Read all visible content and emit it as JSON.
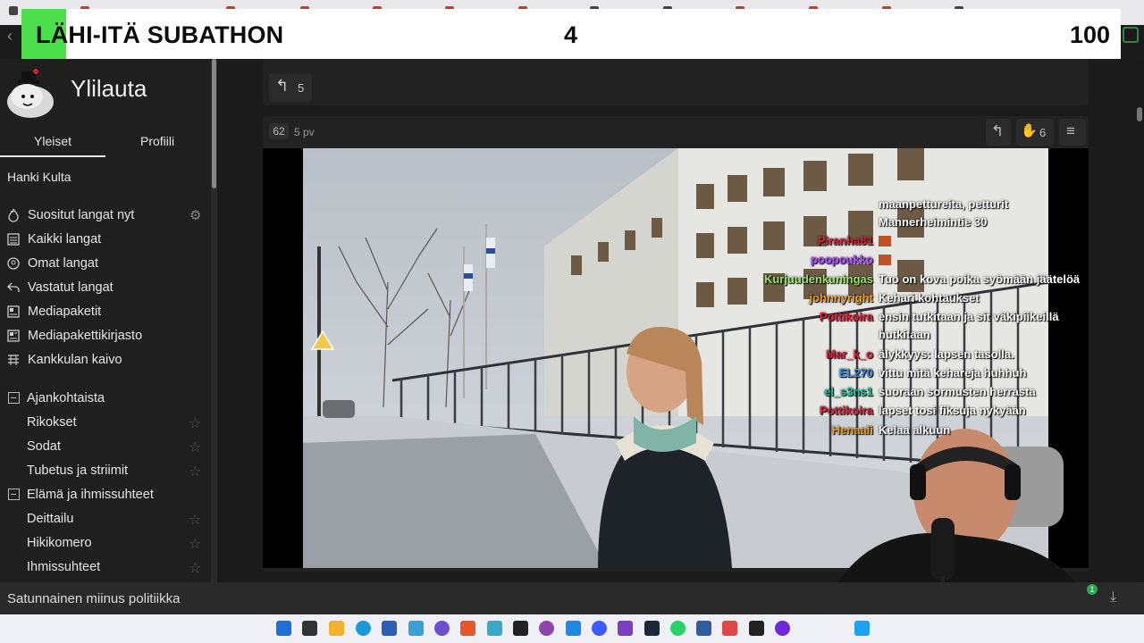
{
  "banner": {
    "title": "LÄHI-ITÄ SUBATHON",
    "count": "4",
    "goal": "100"
  },
  "site": {
    "title": "Ylilauta"
  },
  "sidebar": {
    "tabs": [
      {
        "label": "Yleiset"
      },
      {
        "label": "Profiili"
      }
    ],
    "hanki": "Hanki Kulta",
    "nav": [
      {
        "label": "Suositut langat nyt",
        "icon": "fire-icon"
      },
      {
        "label": "Kaikki langat",
        "icon": "list-icon"
      },
      {
        "label": "Omat langat",
        "icon": "chat-icon"
      },
      {
        "label": "Vastatut langat",
        "icon": "reply-icon"
      },
      {
        "label": "Mediapaketit",
        "icon": "media-icon"
      },
      {
        "label": "Mediapakettikirjasto",
        "icon": "library-icon"
      },
      {
        "label": "Kankkulan kaivo",
        "icon": "well-icon"
      }
    ],
    "categories": [
      {
        "label": "Ajankohtaista",
        "subs": [
          {
            "label": "Rikokset"
          },
          {
            "label": "Sodat"
          },
          {
            "label": "Tubetus ja striimit"
          }
        ]
      },
      {
        "label": "Elämä ja ihmissuhteet",
        "subs": [
          {
            "label": "Deittailu"
          },
          {
            "label": "Hikikomero"
          },
          {
            "label": "Ihmissuhteet"
          }
        ]
      }
    ]
  },
  "post_prev": {
    "reply_count": "5"
  },
  "post": {
    "number": "62",
    "age": "5 pv",
    "likes": "6"
  },
  "chat": [
    {
      "name": "",
      "color": "#ffffff",
      "msg": "maanpettureita, petturit"
    },
    {
      "name": "",
      "color": "#ffffff",
      "msg": "Mannerheimintie 30"
    },
    {
      "name": "Piranha81",
      "color": "#e2233e",
      "msg": ""
    },
    {
      "name": "poopoukko",
      "color": "#b44cff",
      "msg": ""
    },
    {
      "name": "Kurjuudenkuningas",
      "color": "#9be36b",
      "msg": "Tuo on kova poika syömään jäätelöä"
    },
    {
      "name": "johnnyright",
      "color": "#f0a020",
      "msg": "Kehari kohtaukset"
    },
    {
      "name": "Pottikoira",
      "color": "#e2233e",
      "msg": "ensin tutkitaan ja sit väkipiikeillä"
    },
    {
      "name": "",
      "color": "#ffffff",
      "msg": "hutkitaan"
    },
    {
      "name": "Mar_k_o",
      "color": "#e2233e",
      "msg": "älykkyys: lapsen tasolla."
    },
    {
      "name": "EL270",
      "color": "#3a8fe8",
      "msg": "vittu mitä kehareja huhhuh"
    },
    {
      "name": "el_s3ns1",
      "color": "#22c49a",
      "msg": "suoraan sormusten herrasta"
    },
    {
      "name": "Pottikoira",
      "color": "#e2233e",
      "msg": "lapset tosi fiksuja nykyään"
    },
    {
      "name": "Henaali",
      "color": "#f0a020",
      "msg": "Kelaa alkuun"
    }
  ],
  "bottom": {
    "text": "Satunnainen miinus politiikka",
    "badge": "1"
  }
}
